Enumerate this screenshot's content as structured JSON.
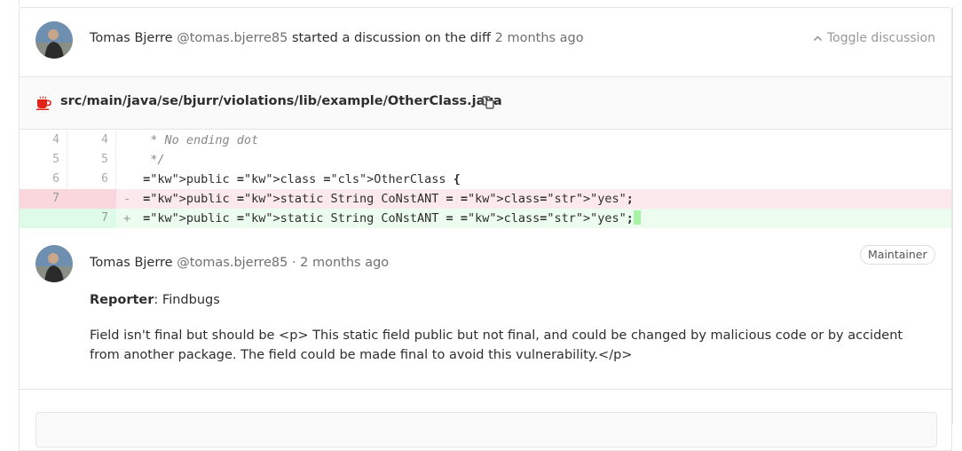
{
  "discussion": {
    "author_name": "Tomas Bjerre",
    "author_handle": "@tomas.bjerre85",
    "action": "started a discussion on the diff",
    "time_ago": "2 months ago",
    "toggle_label": "Toggle discussion"
  },
  "file": {
    "path": "src/main/java/se/bjurr/violations/lib/example/OtherClass.java",
    "icon": "java-coffee-icon"
  },
  "diff": {
    "lines": [
      {
        "old": "4",
        "new": "4",
        "type": "context",
        "marker": " ",
        "text": "  * No ending dot"
      },
      {
        "old": "5",
        "new": "5",
        "type": "context",
        "marker": " ",
        "text": "  */"
      },
      {
        "old": "6",
        "new": "6",
        "type": "context",
        "marker": " ",
        "text": " public class OtherClass {"
      },
      {
        "old": "7",
        "new": "",
        "type": "del",
        "marker": "-",
        "text": " public static String CoNstANT = \"yes\";"
      },
      {
        "old": "",
        "new": "7",
        "type": "add",
        "marker": "+",
        "text": " public static String CoNstANT = \"yes\";"
      }
    ]
  },
  "note": {
    "author_name": "Tomas Bjerre",
    "author_handle": "@tomas.bjerre85",
    "separator": "·",
    "time_ago": "2 months ago",
    "role_badge": "Maintainer",
    "reporter_label": "Reporter",
    "reporter_value": ": Findbugs",
    "message": "Field isn't final but should be <p> This static field public but not final, and could be changed by malicious code or by accident from another package. The field could be made final to avoid this vulnerability.</p>"
  },
  "colors": {
    "del_bg": "#fbe9eb",
    "add_bg": "#ecfdf0",
    "string": "#dd1144",
    "class_name": "#445588"
  }
}
